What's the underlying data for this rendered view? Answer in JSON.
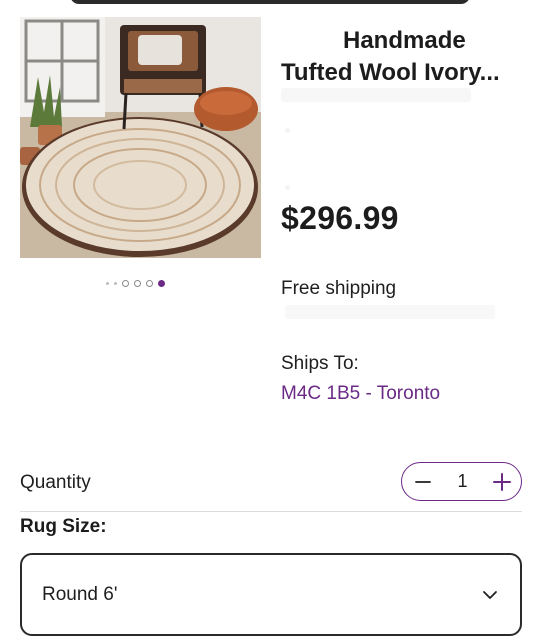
{
  "product": {
    "title_line1": "Handmade",
    "title_line2": "Tufted Wool Ivory...",
    "price": "$296.99",
    "image_icon": "rug-product-photo"
  },
  "gallery": {
    "image_count": 6,
    "active_index": 5
  },
  "shipping": {
    "label": "Free shipping",
    "ships_to_label": "Ships To:",
    "location": "M4C 1B5 - Toronto"
  },
  "quantity": {
    "label": "Quantity",
    "value": "1",
    "decrement_icon": "minus-icon",
    "increment_icon": "plus-icon"
  },
  "rug_size": {
    "label": "Rug Size:",
    "selected": "Round 6'",
    "dropdown_icon": "chevron-down-icon"
  },
  "colors": {
    "accent": "#6b2a86",
    "text": "#1f1f1f",
    "border": "#2a2a2a"
  }
}
